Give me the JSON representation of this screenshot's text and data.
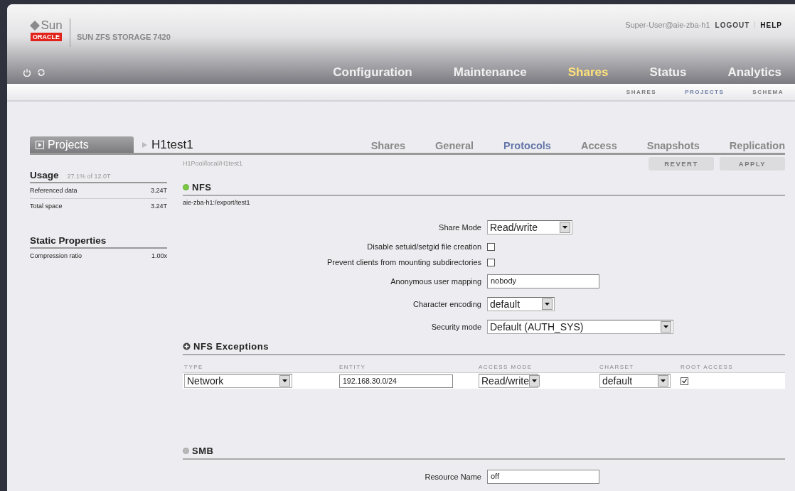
{
  "header": {
    "logo_top": "Sun",
    "logo_bottom": "ORACLE",
    "product": "SUN ZFS STORAGE 7420",
    "user": "Super-User@aie-zba-h1",
    "links": [
      "LOGOUT",
      "HELP"
    ],
    "nav": [
      {
        "label": "Configuration",
        "selected": false
      },
      {
        "label": "Maintenance",
        "selected": false
      },
      {
        "label": "Shares",
        "selected": true
      },
      {
        "label": "Status",
        "selected": false
      },
      {
        "label": "Analytics",
        "selected": false
      }
    ],
    "subnav": [
      {
        "label": "SHARES",
        "selected": false
      },
      {
        "label": "PROJECTS",
        "selected": true
      },
      {
        "label": "SCHEMA",
        "selected": false
      }
    ]
  },
  "projects_button": "Projects",
  "breadcrumb": "H1test1",
  "tabs": [
    {
      "label": "Shares",
      "selected": false
    },
    {
      "label": "General",
      "selected": false
    },
    {
      "label": "Protocols",
      "selected": true
    },
    {
      "label": "Access",
      "selected": false
    },
    {
      "label": "Snapshots",
      "selected": false
    },
    {
      "label": "Replication",
      "selected": false
    }
  ],
  "path": "H1Pool/local/H1test1",
  "buttons": [
    {
      "label": "REVERT",
      "disabled": true
    },
    {
      "label": "APPLY",
      "disabled": true
    }
  ],
  "sidebar": {
    "usage": {
      "title": "Usage",
      "summary": "27.1% of 12.0T",
      "rows": [
        {
          "label": "Referenced data",
          "value": "3.24T"
        },
        {
          "label": "Total space",
          "value": "3.24T"
        }
      ]
    },
    "static": {
      "title": "Static Properties",
      "rows": [
        {
          "label": "Compression ratio",
          "value": "1.00x"
        }
      ]
    }
  },
  "nfs": {
    "title": "NFS",
    "enabled": true,
    "mount": "aie-zba-h1:/export/test1",
    "fields": [
      {
        "kind": "select",
        "label": "Share Mode",
        "value": "Read/write"
      },
      {
        "kind": "checkbox",
        "label": "Disable setuid/setgid file creation",
        "checked": false
      },
      {
        "kind": "checkbox",
        "label": "Prevent clients from mounting subdirectories",
        "checked": false
      },
      {
        "kind": "text",
        "label": "Anonymous user mapping",
        "value": "nobody"
      },
      {
        "kind": "select",
        "label": "Character encoding",
        "value": "default"
      },
      {
        "kind": "select",
        "label": "Security mode",
        "value": "Default (AUTH_SYS)"
      }
    ]
  },
  "exceptions": {
    "title": "NFS Exceptions",
    "columns": [
      "TYPE",
      "ENTITY",
      "ACCESS MODE",
      "CHARSET",
      "ROOT ACCESS"
    ],
    "rows": [
      {
        "type": "Network",
        "entity": "192.168.30.0/24",
        "access_mode": "Read/write",
        "charset": "default",
        "root_access": true
      }
    ]
  },
  "smb": {
    "title": "SMB",
    "enabled": false,
    "fields": [
      {
        "kind": "text",
        "label": "Resource Name",
        "value": "off"
      }
    ]
  }
}
